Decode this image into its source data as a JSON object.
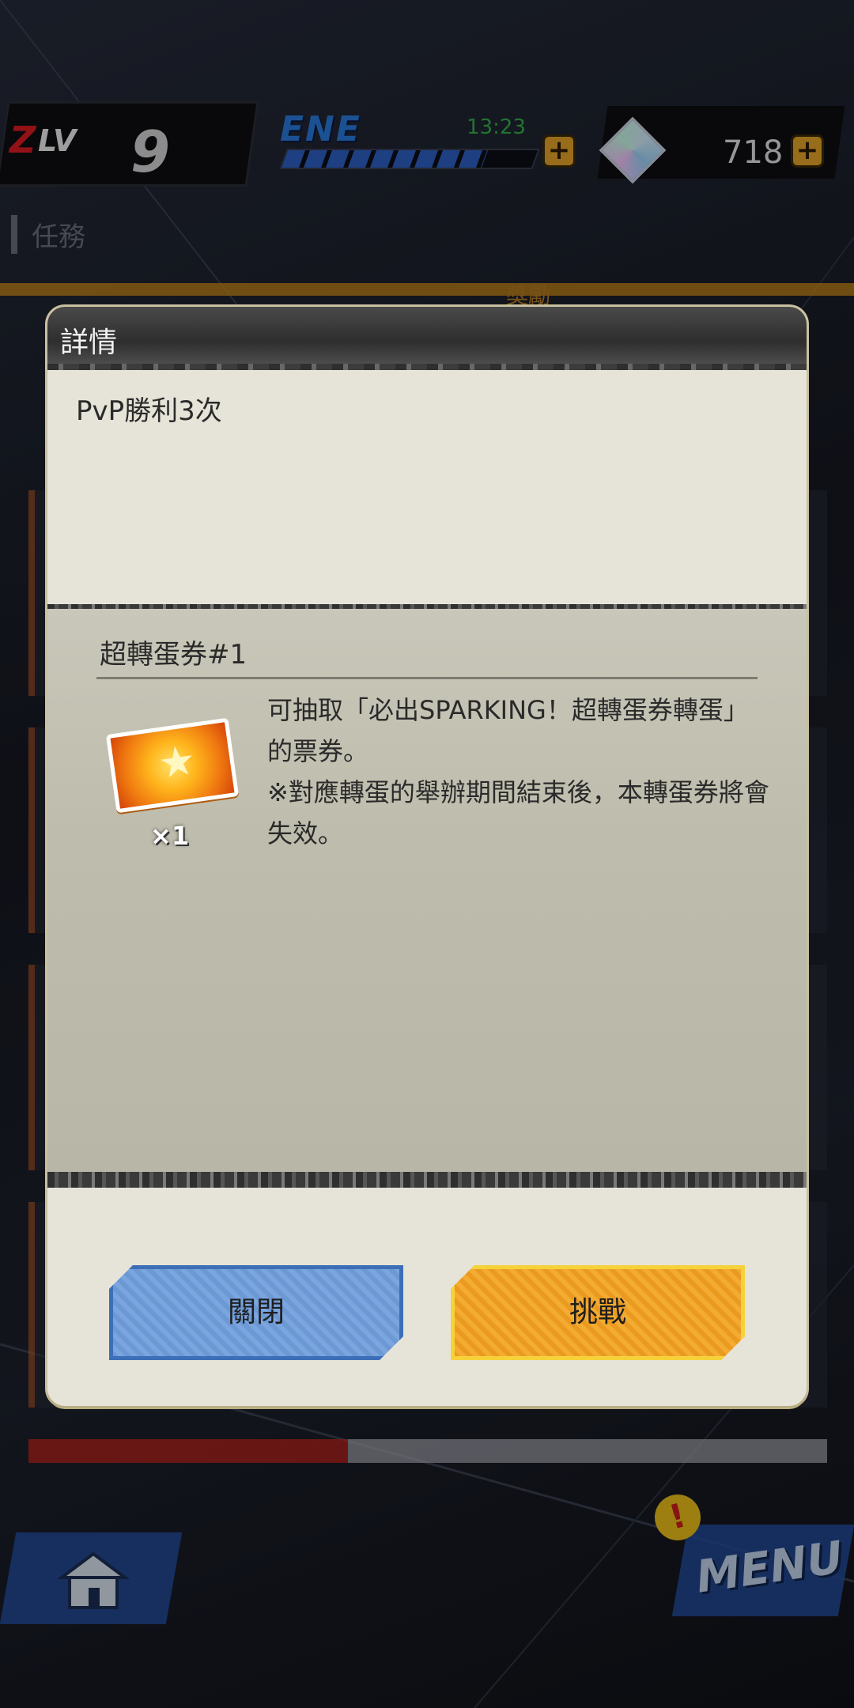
{
  "status_bar": {
    "level_prefix": "Z",
    "level_label": "LV",
    "level_value": "9",
    "energy_label": "ENE",
    "energy_timer": "13:23",
    "energy_fill_fraction": 0.8,
    "gem_count": "718",
    "add_symbol": "+"
  },
  "background": {
    "section_title": "任務",
    "reward_tab": "獎勵",
    "menu_label": "MENU",
    "alert_symbol": "!"
  },
  "modal": {
    "title": "詳情",
    "condition": "PvP勝利3次",
    "reward": {
      "name": "超轉蛋券#1",
      "icon": "gacha-ticket-icon",
      "quantity": "×1",
      "description_line1": "可抽取「必出SPARKING！超轉蛋券轉蛋」的票券。",
      "description_line2": "※對應轉蛋的舉辦期間結束後，本轉蛋券將會失效。"
    },
    "buttons": {
      "close_label": "關閉",
      "challenge_label": "挑戰"
    }
  },
  "colors": {
    "modal_bg": "#e6e4d8",
    "close_button": "#7aa5de",
    "challenge_button": "#f3ab32",
    "energy_timer": "#37b24a",
    "energy_label": "#2a7de0"
  }
}
